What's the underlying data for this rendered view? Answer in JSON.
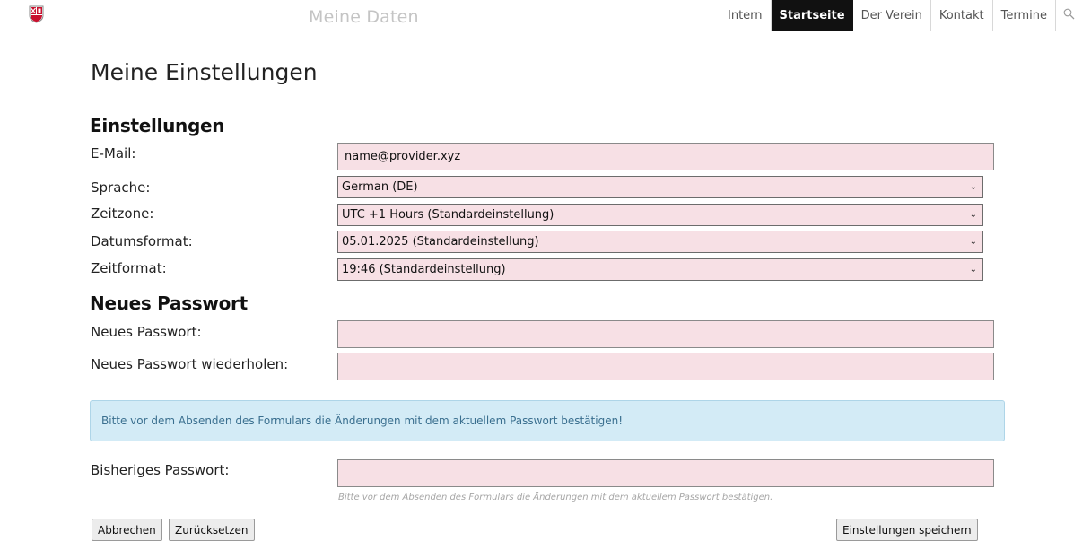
{
  "header": {
    "page_heading": "Meine Daten",
    "nav": [
      {
        "label": "Intern"
      },
      {
        "label": "Startseite",
        "active": true
      },
      {
        "label": "Der Verein"
      },
      {
        "label": "Kontakt"
      },
      {
        "label": "Termine"
      }
    ],
    "search_icon": "search-icon"
  },
  "main": {
    "title": "Meine Einstellungen",
    "settings": {
      "heading": "Einstellungen",
      "email_label": "E-Mail:",
      "email_value": "name@provider.xyz",
      "language_label": "Sprache:",
      "language_value": "German (DE)",
      "timezone_label": "Zeitzone:",
      "timezone_value": "UTC +1 Hours (Standardeinstellung)",
      "dateformat_label": "Datumsformat:",
      "dateformat_value": "05.01.2025 (Standardeinstellung)",
      "timeformat_label": "Zeitformat:",
      "timeformat_value": "19:46 (Standardeinstellung)"
    },
    "password": {
      "heading": "Neues Passwort",
      "new_label": "Neues Passwort:",
      "repeat_label": "Neues Passwort wiederholen:"
    },
    "alert_text": "Bitte vor dem Absenden des Formulars die Änderungen mit dem aktuellem Passwort bestätigen!",
    "current_password_label": "Bisheriges Passwort:",
    "current_password_help": "Bitte vor dem Absenden des Formulars die Änderungen mit dem aktuellem Passwort bestätigen.",
    "buttons": {
      "cancel": "Abbrechen",
      "reset": "Zurücksetzen",
      "save": "Einstellungen speichern"
    }
  },
  "colors": {
    "field_background": "#f7e0e5",
    "alert_background": "#d3ebf6",
    "nav_active": "#111111"
  }
}
